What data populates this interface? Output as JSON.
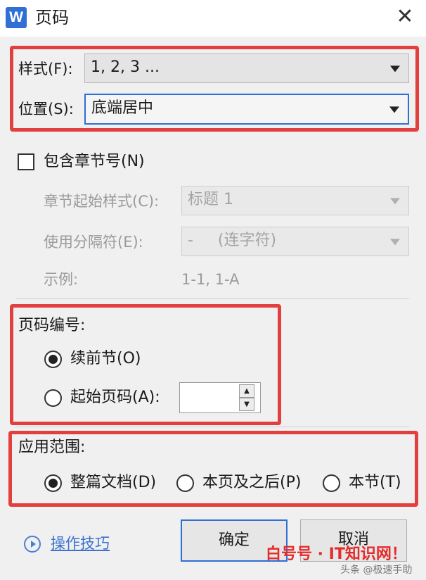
{
  "window": {
    "title": "页码",
    "app_icon_letter": "W",
    "close_glyph": "✕"
  },
  "style_row": {
    "label": "样式(F):",
    "value": "1, 2, 3 ..."
  },
  "position_row": {
    "label": "位置(S):",
    "value": "底端居中"
  },
  "chapter": {
    "checkbox_label": "包含章节号(N)",
    "checked": false,
    "start_style_label": "章节起始样式(C):",
    "start_style_value": "标题 1",
    "separator_label": "使用分隔符(E):",
    "separator_value": "-     (连字符)",
    "example_label": "示例:",
    "example_value": "1-1, 1-A"
  },
  "numbering": {
    "heading": "页码编号:",
    "continue_label": "续前节(O)",
    "start_label": "起始页码(A):",
    "start_value": "",
    "selected": "continue"
  },
  "apply_range": {
    "heading": "应用范围:",
    "options": [
      "整篇文档(D)",
      "本页及之后(P)",
      "本节(T)"
    ],
    "selected_index": 0
  },
  "buttons": {
    "ok": "确定",
    "cancel": "取消"
  },
  "tips": {
    "label": "操作技巧"
  },
  "watermark": {
    "brand": "白号号 · IT知识网！",
    "credit": "头条 @极速手助"
  },
  "colors": {
    "accent": "#2f6fd6",
    "highlight": "#e2403f"
  }
}
